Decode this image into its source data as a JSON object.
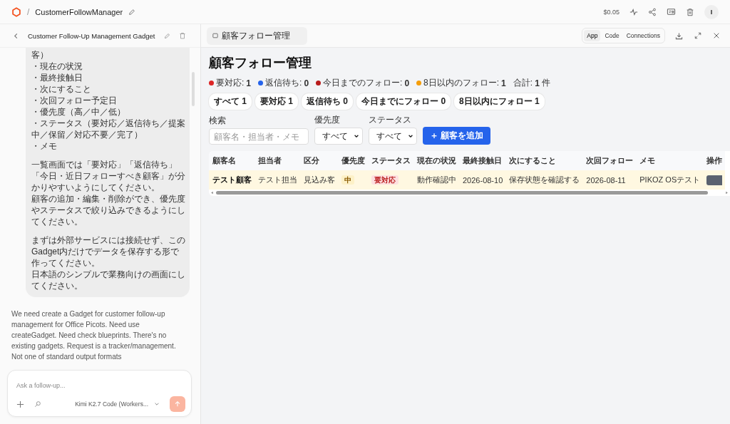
{
  "topbar": {
    "breadcrumb_separator": "/",
    "project": "CustomerFollowManager",
    "cost": "$0.05",
    "avatar": "I"
  },
  "chat": {
    "title": "Customer Follow-Up Management Gadget",
    "user_message": [
      [
        "客）",
        "・現在の状況",
        "・最終接触日",
        "・次にすること",
        "・次回フォロー予定日",
        "・優先度（高／中／低）",
        "・ステータス（要対応／返信待ち／提案中／保留／対応不要／完了）",
        "・メモ"
      ],
      [
        "一覧画面では「要対応」「返信待ち」「今日・近日フォローすべき顧客」が分かりやすいようにしてください。",
        "顧客の追加・編集・削除ができ、優先度やステータスで絞り込みできるようにしてください。"
      ],
      [
        "まずは外部サービスには接続せず、このGadget内だけでデータを保存する形で作ってください。",
        "日本語のシンプルで業務向けの画面にしてください。"
      ]
    ],
    "assistant_message": "We need create a Gadget for customer follow-up management for Office Picots. Need use createGadget. Need check blueprints. There's no existing gadgets. Request is a tracker/management. Not one of standard output formats",
    "input": {
      "placeholder": "Ask a follow-up..."
    },
    "model": "Kimi K2.7 Code (Workers..."
  },
  "preview": {
    "tab_title": "顧客フォロー管理",
    "view_tabs": [
      {
        "label": "App",
        "selected": true
      },
      {
        "label": "Code",
        "selected": false
      },
      {
        "label": "Connections",
        "selected": false
      }
    ],
    "app": {
      "title": "顧客フォロー管理",
      "stats": [
        {
          "label": "要対応:",
          "value": "1",
          "color": "#dc2626"
        },
        {
          "label": "返信待ち:",
          "value": "0",
          "color": "#2563eb"
        },
        {
          "label": "今日までのフォロー:",
          "value": "0",
          "color": "#b91c1c"
        },
        {
          "label": "8日以内のフォロー:",
          "value": "1",
          "color": "#f59e0b"
        }
      ],
      "total": {
        "label": "合計:",
        "value": "1",
        "unit": "件"
      },
      "filter_chips": [
        "すべて 1",
        "要対応 1",
        "返信待ち 0",
        "今日までにフォロー 0",
        "8日以内にフォロー 1"
      ],
      "filters": [
        {
          "kind": "text",
          "label": "検索",
          "placeholder": "顧客名・担当者・メモ"
        },
        {
          "kind": "select",
          "label": "優先度",
          "value": "すべて"
        },
        {
          "kind": "select",
          "label": "ステータス",
          "value": "すべて"
        }
      ],
      "add_button": "＋ 顧客を追加",
      "table": {
        "columns": [
          "顧客名",
          "担当者",
          "区分",
          "優先度",
          "ステータス",
          "現在の状況",
          "最終接触日",
          "次にすること",
          "次回フォロー",
          "メモ",
          "操作"
        ],
        "rows": [
          {
            "highlighted": true,
            "cells": [
              {
                "kind": "name",
                "text": "テスト顧客"
              },
              {
                "kind": "text",
                "text": "テスト担当"
              },
              {
                "kind": "text",
                "text": "見込み客"
              },
              {
                "kind": "priority",
                "text": "中"
              },
              {
                "kind": "status",
                "text": "要対応"
              },
              {
                "kind": "text",
                "text": "動作確認中"
              },
              {
                "kind": "text",
                "text": "2026-08-10"
              },
              {
                "kind": "text",
                "text": "保存状態を確認する"
              },
              {
                "kind": "text",
                "text": "2026-08-11"
              },
              {
                "kind": "text",
                "text": "PIKOZ OSテスト"
              },
              {
                "kind": "action"
              }
            ]
          }
        ]
      }
    }
  }
}
